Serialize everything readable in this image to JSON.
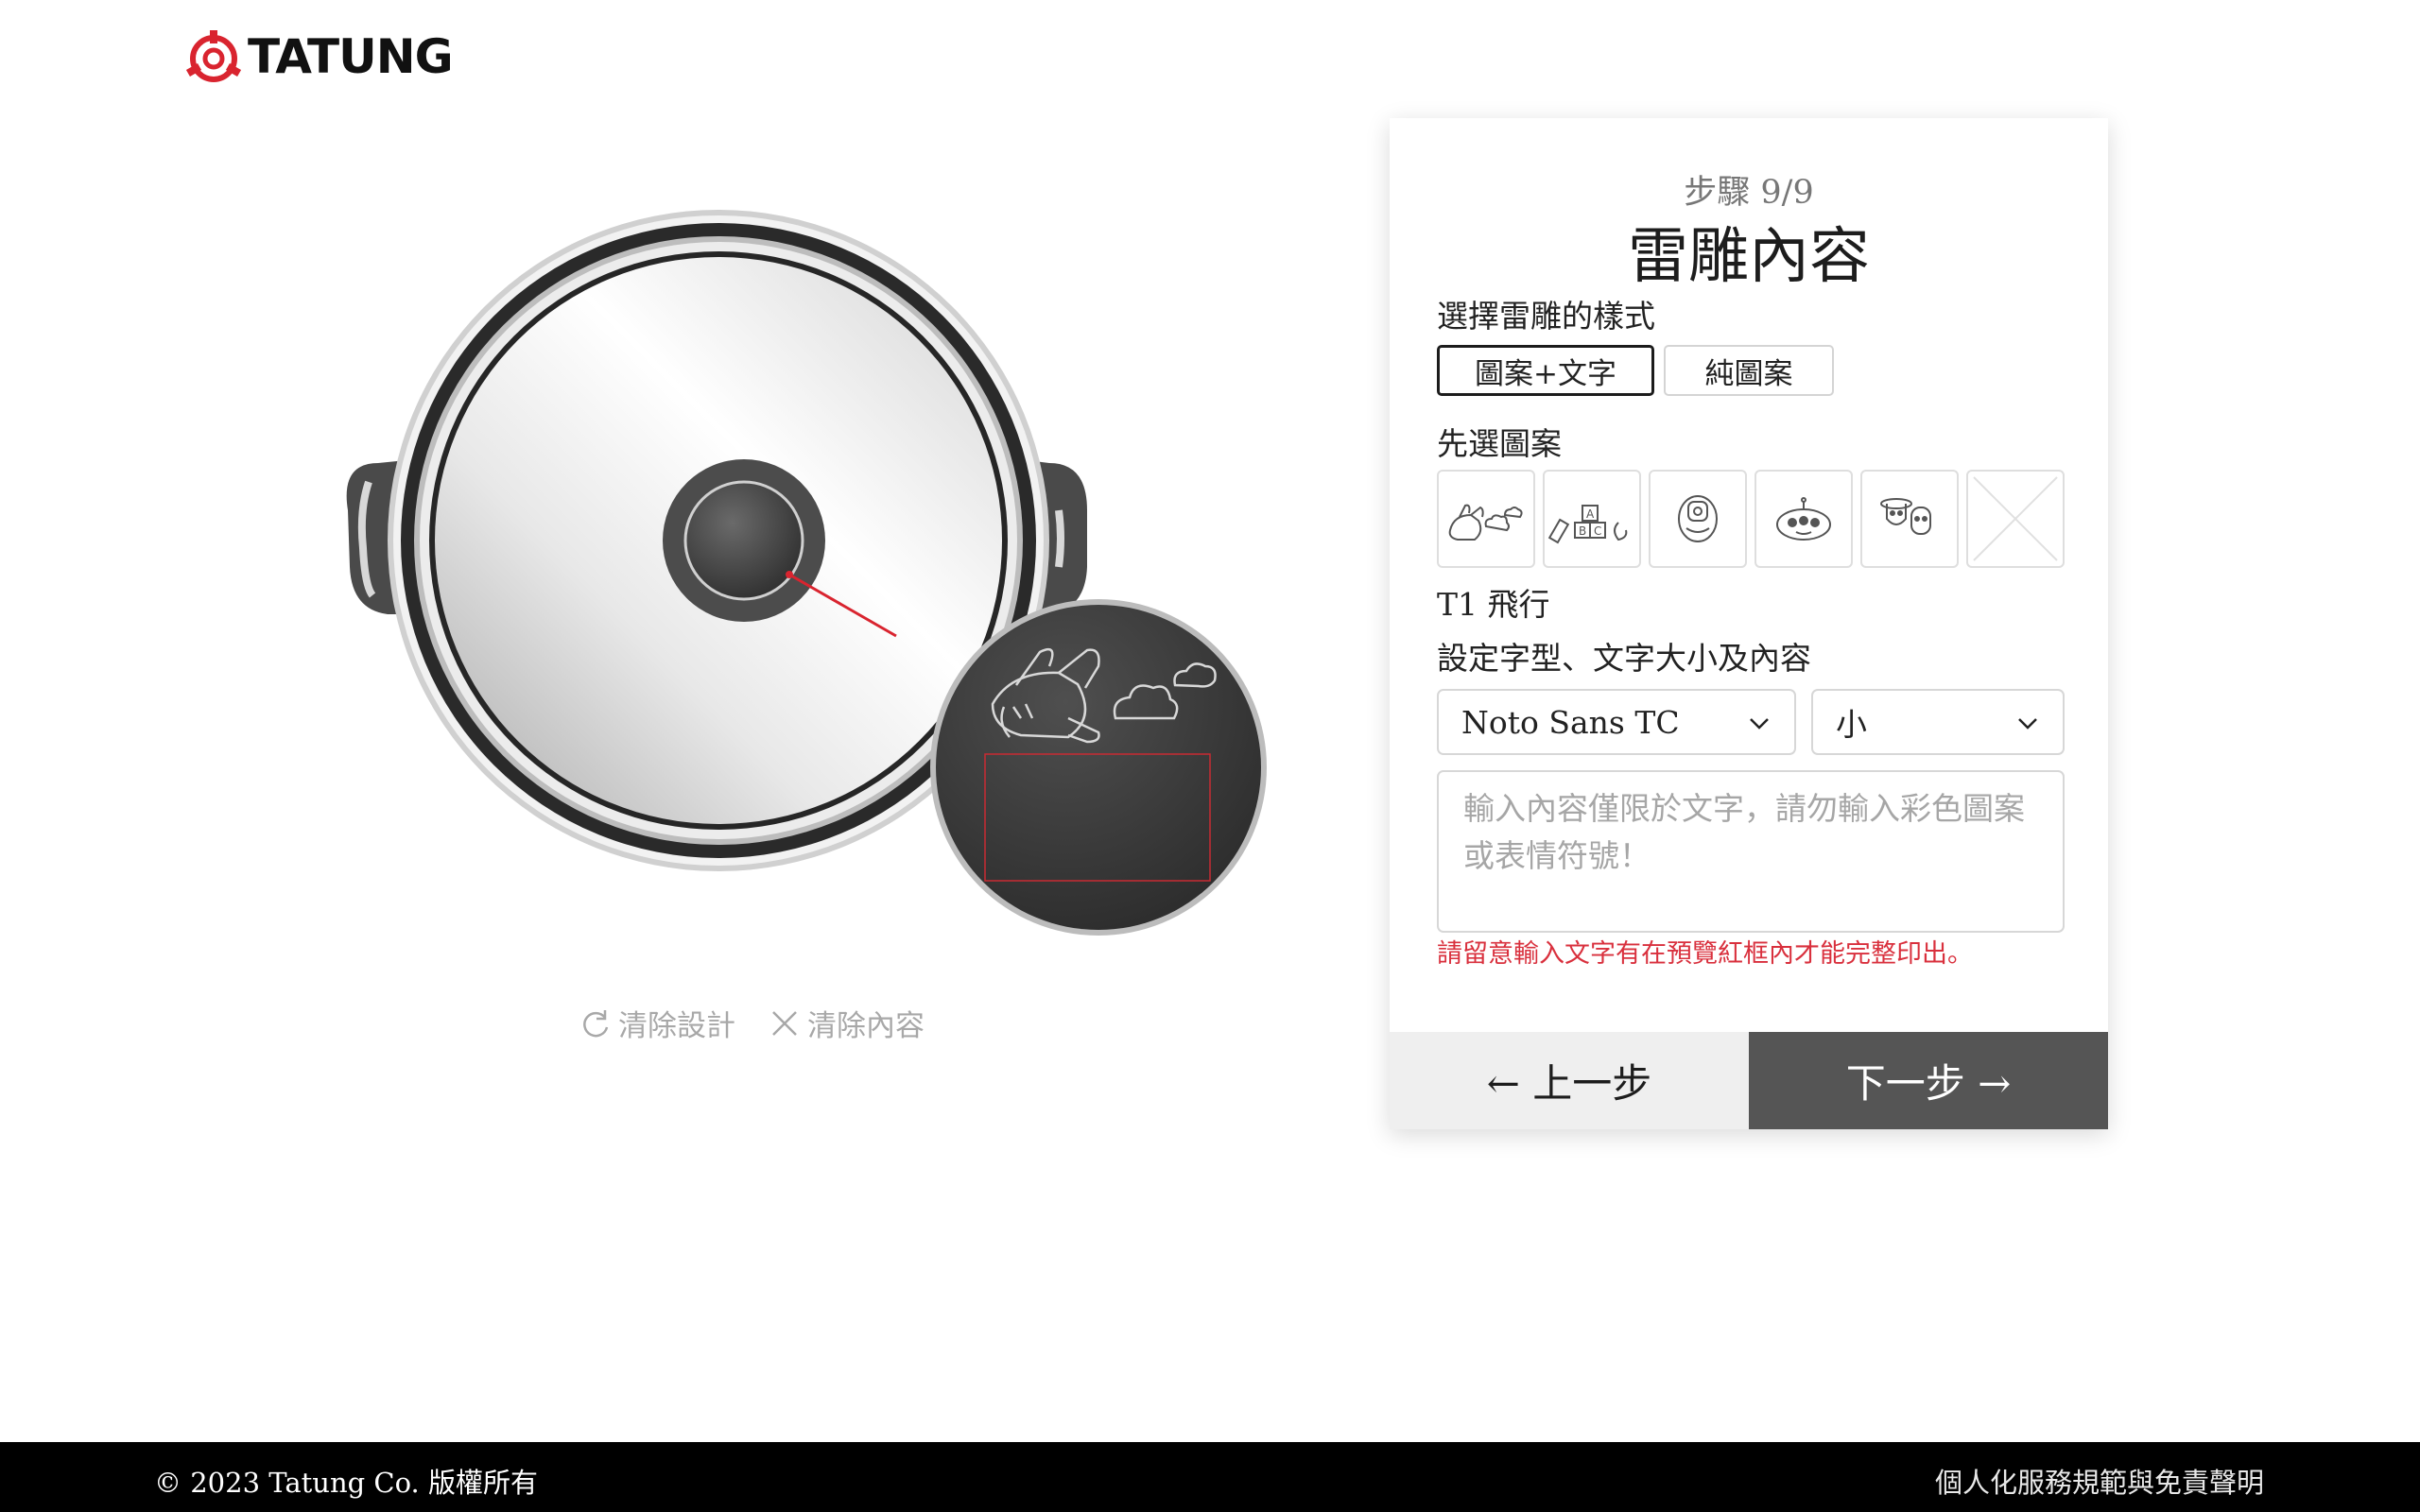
{
  "brand": {
    "name": "TATUNG",
    "accent": "#d9242f"
  },
  "preview": {
    "actions": [
      {
        "label": "清除設計",
        "icon": "refresh-icon"
      },
      {
        "label": "清除內容",
        "icon": "close-icon"
      }
    ]
  },
  "panel": {
    "step": "步驟 9/9",
    "title": "雷雕內容",
    "style_section": {
      "label": "選擇雷雕的樣式",
      "options": [
        "圖案+文字",
        "純圖案"
      ],
      "selected": "圖案+文字"
    },
    "pattern_section": {
      "label": "先選圖案",
      "patterns": [
        "airplane-clouds-icon",
        "abc-blocks-icon",
        "helmet-icon",
        "alien-icon",
        "toy-characters-icon",
        "no-pattern-icon"
      ],
      "selected_name": "T1 飛行"
    },
    "text_section": {
      "label": "設定字型、文字大小及內容",
      "font": "Noto Sans TC",
      "size": "小",
      "placeholder": "輸入內容僅限於文字，請勿輸入彩色圖案或表情符號！",
      "value": "",
      "warning": "請留意輸入文字有在預覽紅框內才能完整印出。"
    },
    "nav": {
      "prev": "← 上一步",
      "next": "下一步 →"
    }
  },
  "footer": {
    "copyright": "© 2023 Tatung Co. 版權所有",
    "disclaimer": "個人化服務規範與免責聲明"
  },
  "colors": {
    "warning": "#d9303d",
    "next_bg": "#555555",
    "prev_bg": "#efefef"
  }
}
